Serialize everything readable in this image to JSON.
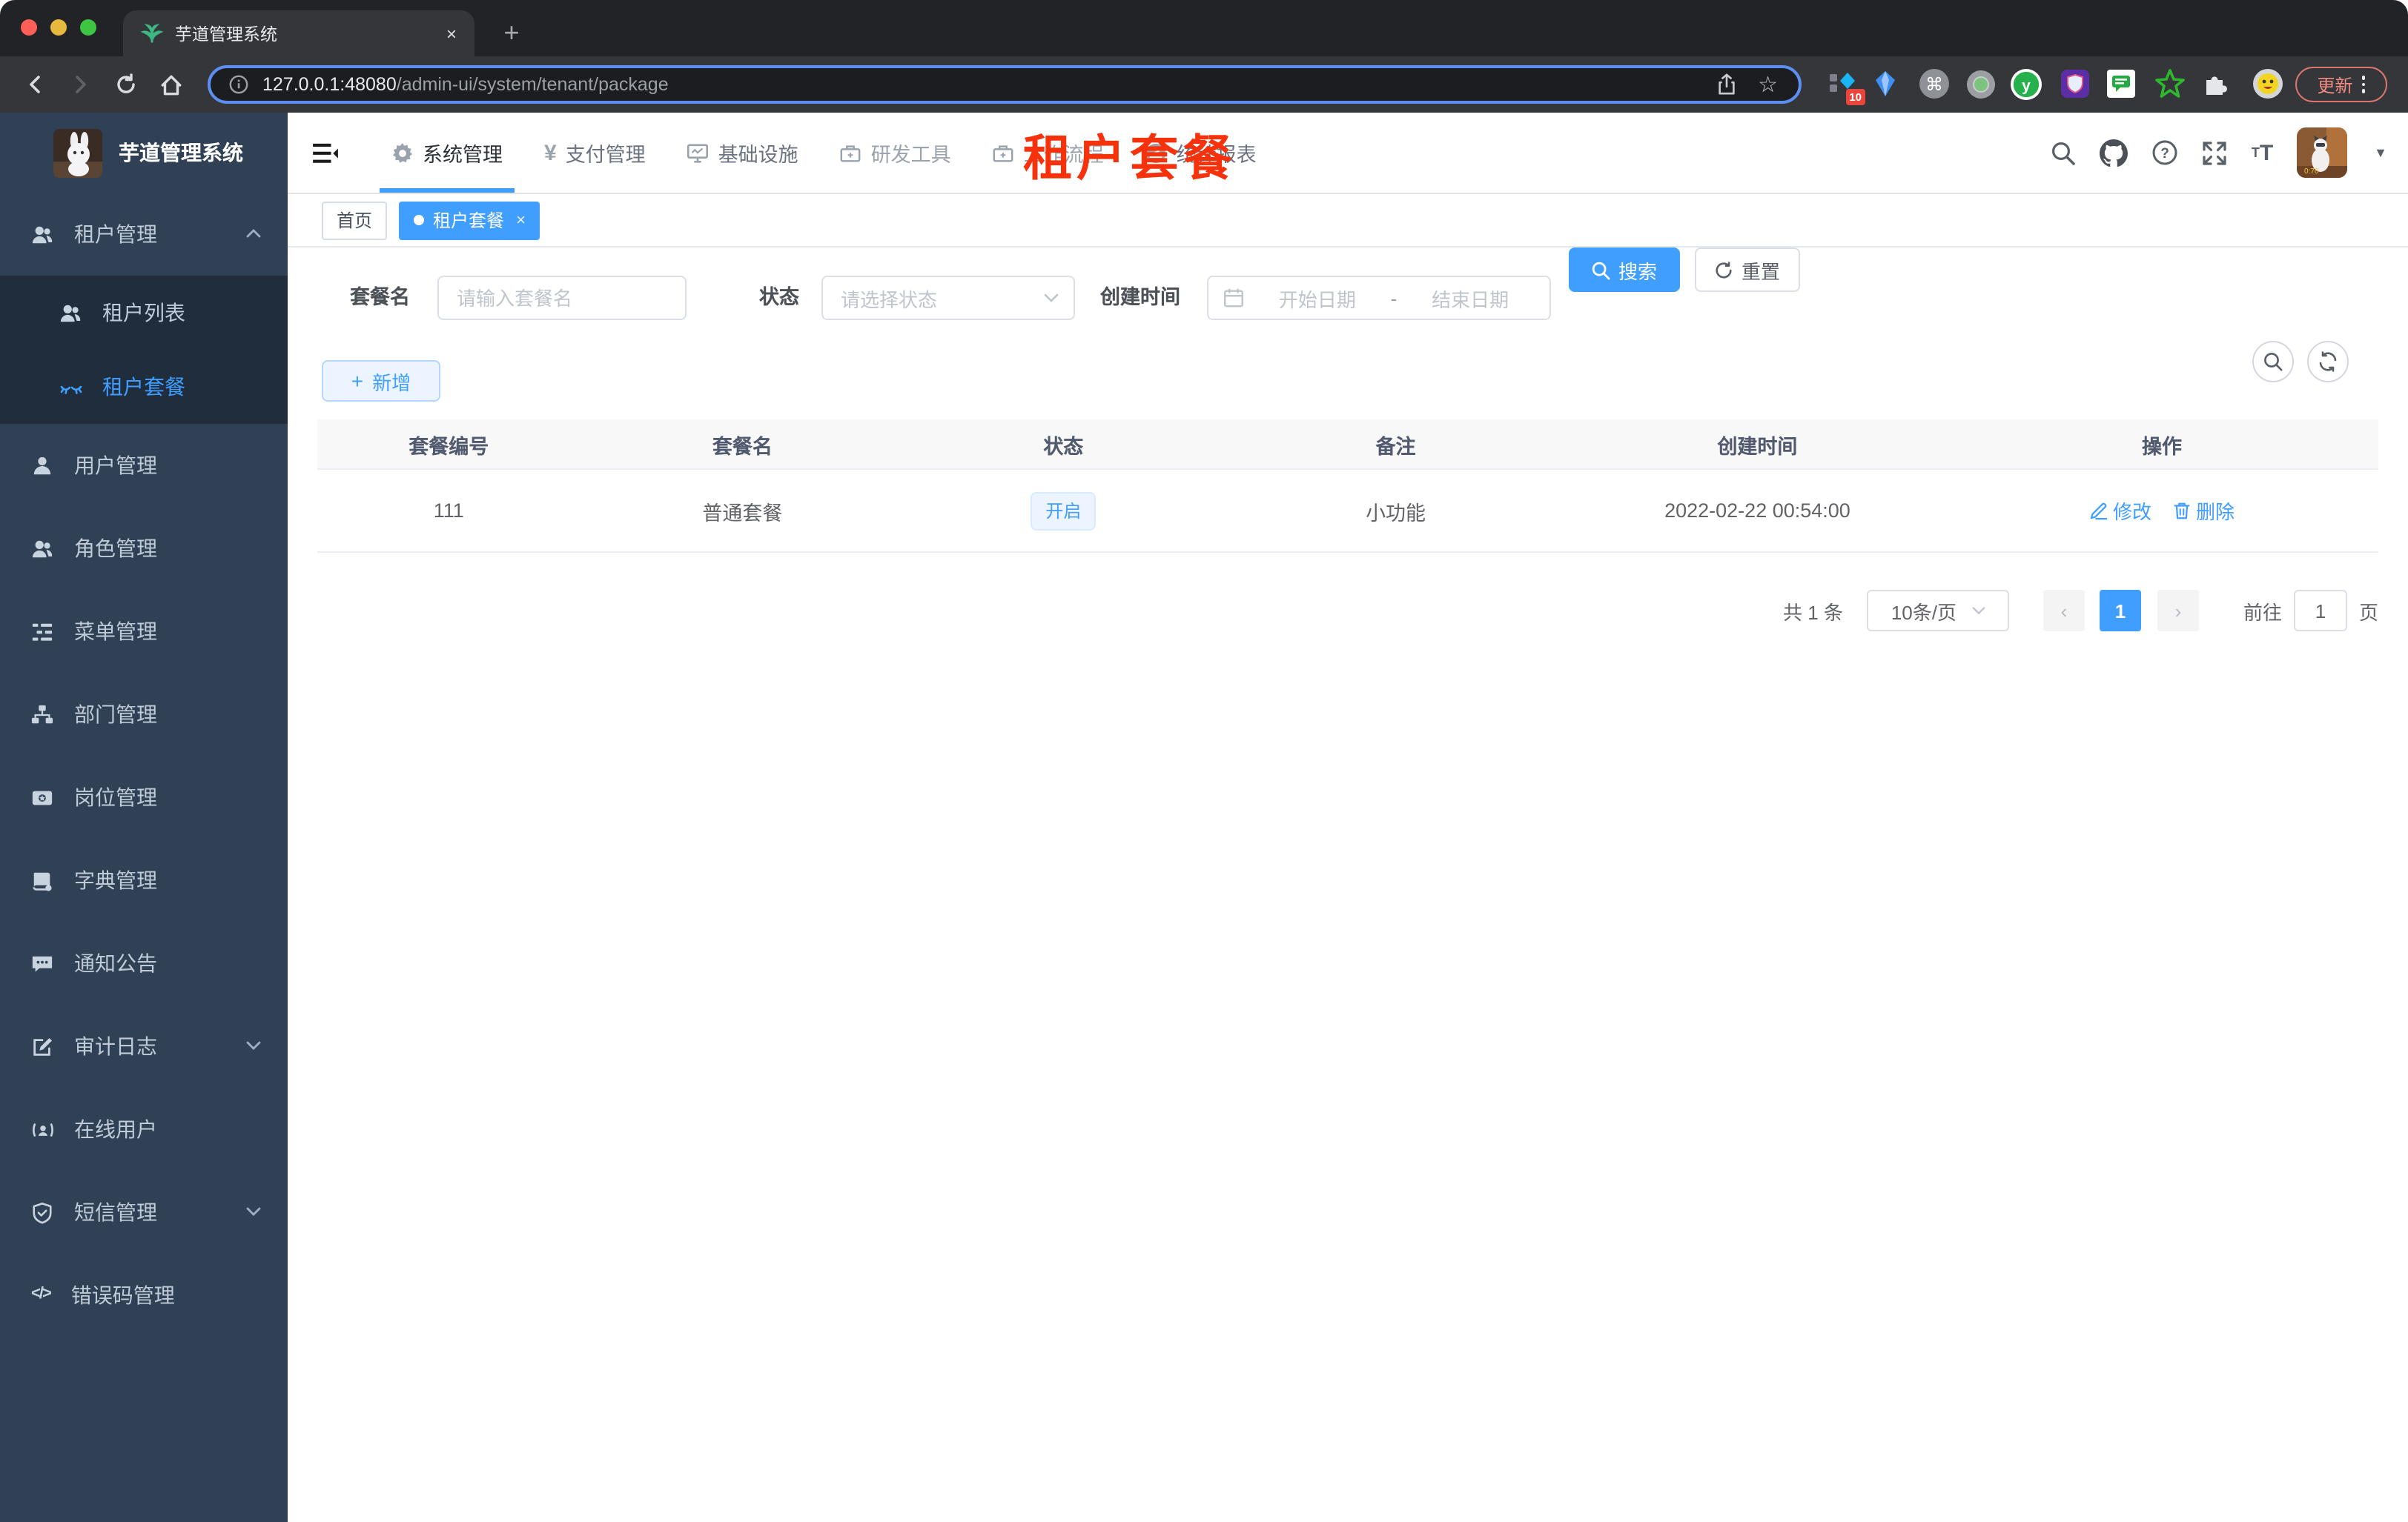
{
  "browser": {
    "tab_title": "芋道管理系统",
    "tab_close": "×",
    "new_tab": "+",
    "url_host": "127.0.0.1:48080",
    "url_path": "/admin-ui/system/tenant/package",
    "bookmark_star": "☆",
    "extension_badge": "10",
    "command_glyph": "⌘",
    "extension_y_label": "y",
    "update_button": "更新"
  },
  "app": {
    "logo_title": "芋道管理系统",
    "nav_items": [
      {
        "label": "系统管理",
        "icon": "gear-icon",
        "active": true
      },
      {
        "label": "支付管理",
        "icon": "yen-icon",
        "yen": "¥"
      },
      {
        "label": "基础设施",
        "icon": "monitor-icon"
      },
      {
        "label": "研发工具",
        "icon": "briefcase-icon"
      },
      {
        "label": "工作流程",
        "icon": "briefcase-icon"
      },
      {
        "label": "统计报表",
        "icon": "gauge-icon"
      }
    ]
  },
  "sidebar": {
    "items": [
      {
        "label": "租户管理",
        "icon": "users-icon",
        "caret": "up"
      },
      {
        "label": "租户列表",
        "icon": "users-icon"
      },
      {
        "label": "租户套餐",
        "icon": "lashes-icon",
        "active": true
      },
      {
        "label": "用户管理",
        "icon": "user-icon"
      },
      {
        "label": "角色管理",
        "icon": "users-icon"
      },
      {
        "label": "菜单管理",
        "icon": "tree-list-icon"
      },
      {
        "label": "部门管理",
        "icon": "org-chart-icon"
      },
      {
        "label": "岗位管理",
        "icon": "badge-icon"
      },
      {
        "label": "字典管理",
        "icon": "dictionary-icon"
      },
      {
        "label": "通知公告",
        "icon": "announcement-icon"
      },
      {
        "label": "审计日志",
        "icon": "audit-log-icon",
        "caret": "down"
      },
      {
        "label": "在线用户",
        "icon": "online-user-icon"
      },
      {
        "label": "短信管理",
        "icon": "shield-check-icon",
        "caret": "down"
      },
      {
        "label": "错误码管理",
        "icon": "code-icon",
        "code_glyph": "</>"
      }
    ]
  },
  "tags": {
    "home": "首页",
    "active": "租户套餐",
    "close": "×"
  },
  "overlay_title": "租户套餐",
  "filters": {
    "name_label": "套餐名",
    "name_placeholder": "请输入套餐名",
    "status_label": "状态",
    "status_placeholder": "请选择状态",
    "date_label": "创建时间",
    "date_start": "开始日期",
    "date_separator": "-",
    "date_end": "结束日期",
    "search_label": "搜索",
    "reset_label": "重置"
  },
  "toolbar": {
    "add_label": "新增",
    "plus": "+"
  },
  "table": {
    "headers": [
      "套餐编号",
      "套餐名",
      "状态",
      "备注",
      "创建时间",
      "操作"
    ],
    "rows": [
      {
        "id": "111",
        "name": "普通套餐",
        "status": "开启",
        "remark": "小功能",
        "created": "2022-02-22 00:54:00",
        "edit_label": "修改",
        "delete_label": "删除"
      }
    ]
  },
  "pagination": {
    "total": "共 1 条",
    "page_size": "10条/页",
    "prev": "‹",
    "page": "1",
    "next": "›",
    "goto_label": "前往",
    "goto_value": "1",
    "unit_label": "页"
  },
  "colors": {
    "accent": "#409eff",
    "overlay_red": "#f5320b",
    "sidebar_bg": "#304156",
    "submenu_bg": "#1f2d3d",
    "sidebar_text": "#bfcbd9",
    "status_tag_bg": "#ecf5ff",
    "update_red": "#f28b82",
    "traffic_red": "#ff5f57",
    "traffic_yellow": "#e6b83e",
    "traffic_green": "#3ec543"
  }
}
